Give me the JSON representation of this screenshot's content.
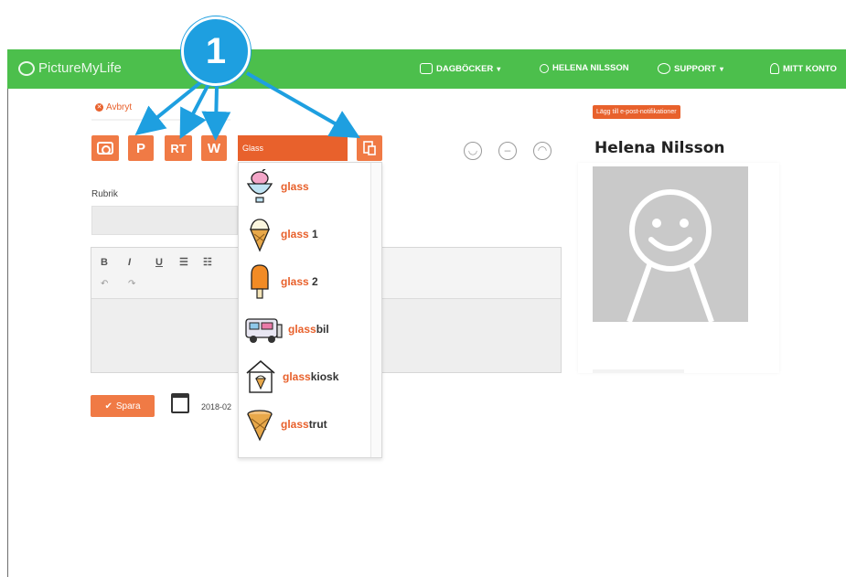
{
  "navbar": {
    "brand": "PictureMyLife",
    "items": [
      {
        "label": "DAGBÖCKER",
        "caret": "▾"
      },
      {
        "label": "HELENA NILSSON"
      },
      {
        "label": "SUPPORT",
        "caret": "▾"
      },
      {
        "label": "MITT KONTO"
      }
    ],
    "color": "#4cbf4c"
  },
  "editor": {
    "cancel_label": "Avbryt",
    "tool_buttons": [
      {
        "name": "camera-icon"
      },
      {
        "label": "P"
      },
      {
        "label": "RT"
      },
      {
        "label": "W"
      },
      {
        "name": "symbol-icon"
      }
    ],
    "search": {
      "value": "Glass"
    },
    "rubrik_label": "Rubrik",
    "toolbar": {
      "bold": "B",
      "italic": "I",
      "underline": "U",
      "bullets": "☰",
      "numbered": "☷",
      "undo": "↶",
      "redo": "↷"
    },
    "save_label": "Spara",
    "date": "2018-02",
    "accent": "#f07a45"
  },
  "dropdown": {
    "results": [
      {
        "label": "glass",
        "match": "glass",
        "rest": "",
        "icon": "ice-cream-cup-icon"
      },
      {
        "label": "glass 1",
        "match": "glass",
        "rest": " 1",
        "icon": "ice-cream-cone-icon"
      },
      {
        "label": "glass 2",
        "match": "glass",
        "rest": " 2",
        "icon": "ice-lolly-icon"
      },
      {
        "label": "glassbil",
        "match": "glass",
        "rest": "bil",
        "icon": "ice-cream-truck-icon"
      },
      {
        "label": "glasskiosk",
        "match": "glass",
        "rest": "kiosk",
        "icon": "ice-cream-kiosk-icon"
      },
      {
        "label": "glasstrut",
        "match": "glass",
        "rest": "trut",
        "icon": "waffle-cone-icon"
      }
    ]
  },
  "profile": {
    "notify_label": "Lägg till e-post-notifikationer",
    "name": "Helena Nilsson"
  },
  "callout": {
    "number": "1",
    "color": "#1e9fe0"
  }
}
